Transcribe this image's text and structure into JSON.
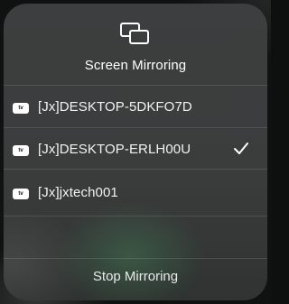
{
  "panel": {
    "title": "Screen Mirroring",
    "icon": "screen-mirroring-icon",
    "devices": [
      {
        "badge_icon": "apple-tv-icon",
        "label": "[Jx]DESKTOP-5DKFO7D",
        "selected": false
      },
      {
        "badge_icon": "apple-tv-icon",
        "label": "[Jx]DESKTOP-ERLH00U",
        "selected": true
      },
      {
        "badge_icon": "apple-tv-icon",
        "label": "[Jx]jxtech001",
        "selected": false
      }
    ],
    "stop_label": "Stop Mirroring"
  }
}
